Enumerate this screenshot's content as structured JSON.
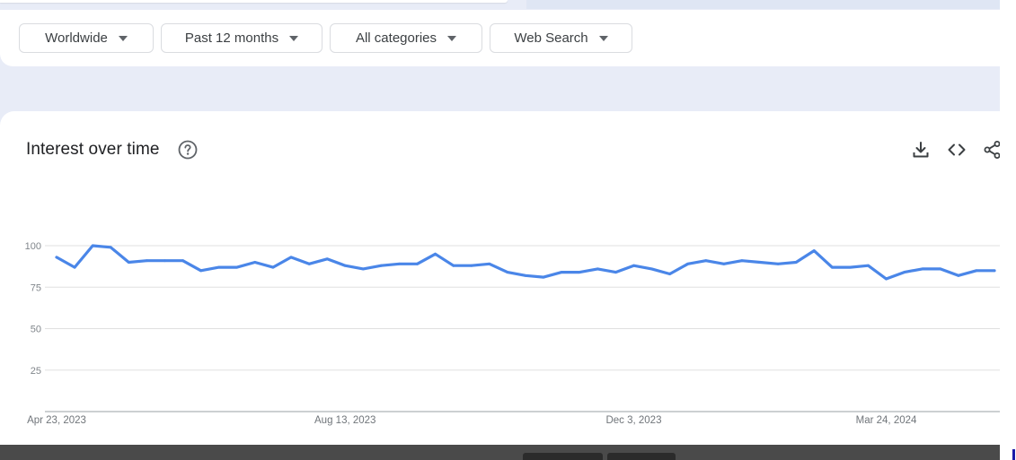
{
  "filters": {
    "region": "Worldwide",
    "time_range": "Past 12 months",
    "category": "All categories",
    "search_type": "Web Search"
  },
  "card": {
    "title": "Interest over time",
    "icons": [
      "help-icon",
      "download-icon",
      "embed-icon",
      "share-icon"
    ]
  },
  "colors": {
    "line": "#4a86e8",
    "grid": "#e0e0e0",
    "axis": "#9aa0a6"
  },
  "chart_data": {
    "type": "line",
    "title": "Interest over time",
    "xlabel": "",
    "ylabel": "",
    "ylim": [
      0,
      100
    ],
    "yticks": [
      25,
      50,
      75,
      100
    ],
    "x_tick_labels": [
      "Apr 23, 2023",
      "Aug 13, 2023",
      "Dec 3, 2023",
      "Mar 24, 2024"
    ],
    "x_tick_positions": [
      0,
      16,
      32,
      46
    ],
    "grid": true,
    "series": [
      {
        "values": [
          93,
          87,
          100,
          99,
          90,
          91,
          91,
          91,
          85,
          87,
          87,
          90,
          87,
          93,
          89,
          92,
          88,
          86,
          88,
          89,
          89,
          95,
          88,
          88,
          89,
          84,
          82,
          81,
          84,
          84,
          86,
          84,
          88,
          86,
          83,
          89,
          91,
          89,
          91,
          90,
          89,
          90,
          97,
          87,
          87,
          88,
          80,
          84,
          86,
          86,
          82,
          85,
          85
        ]
      }
    ]
  }
}
